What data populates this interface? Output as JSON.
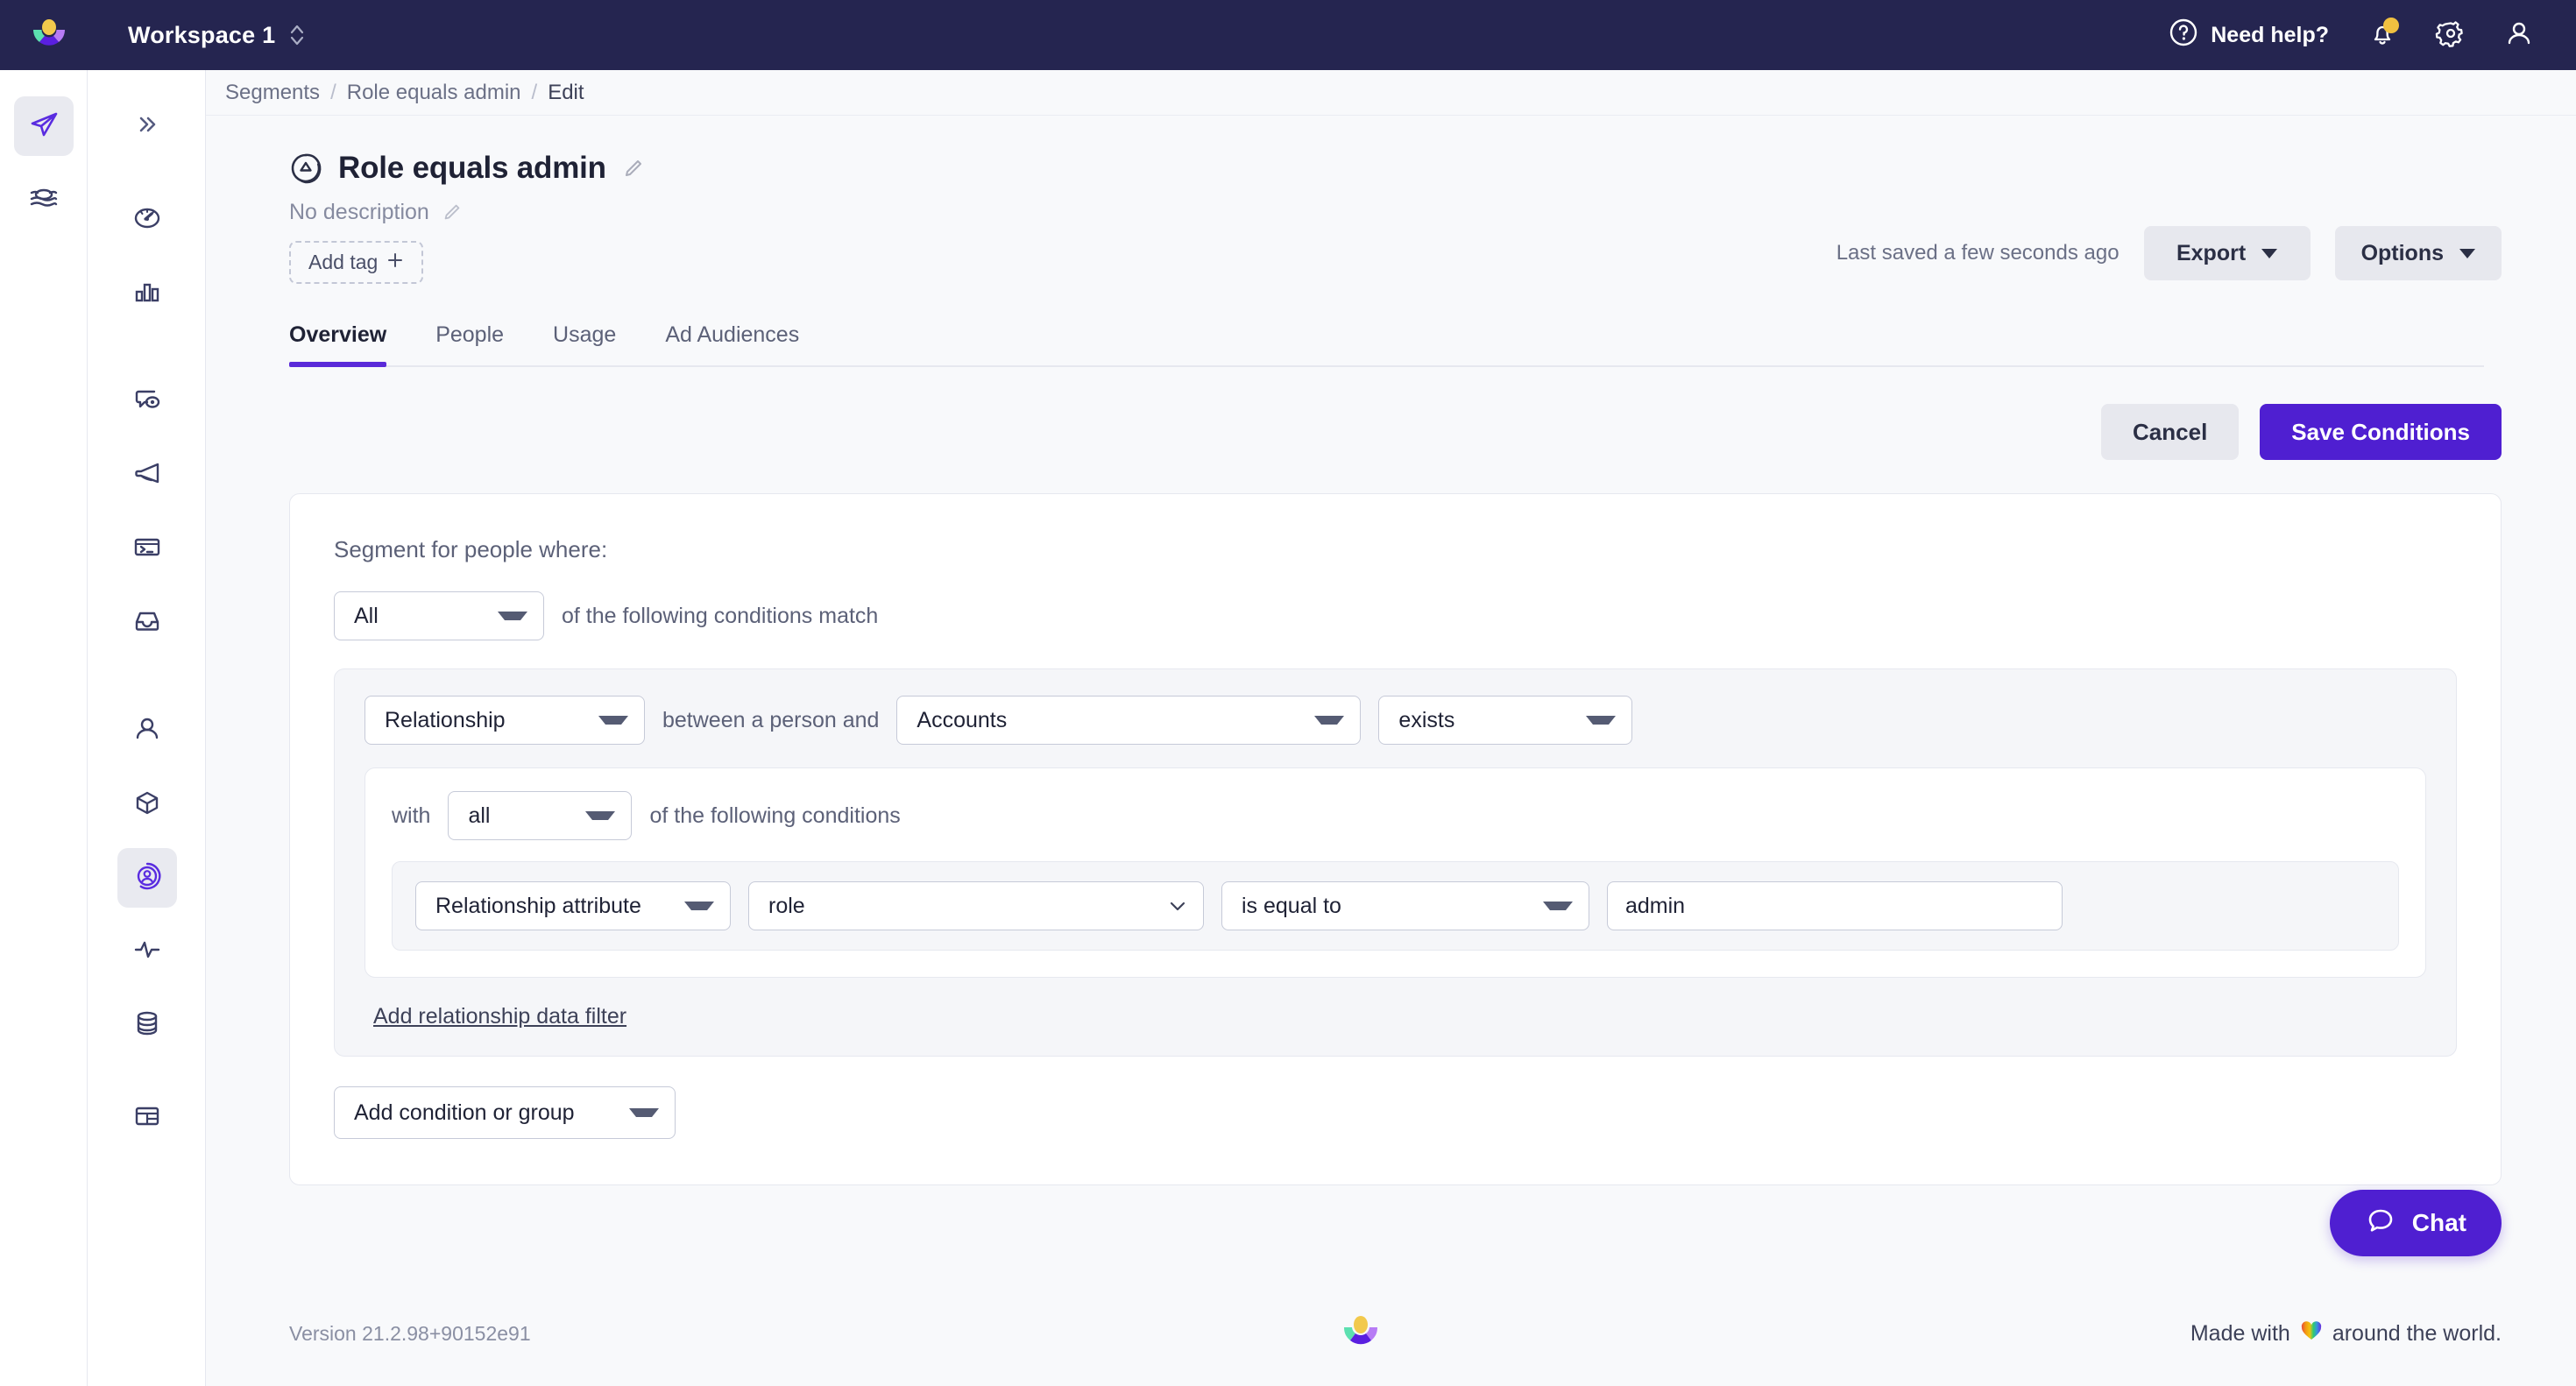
{
  "topbar": {
    "workspace": "Workspace 1",
    "need_help": "Need help?",
    "icons": {
      "logo": "customerio-logo",
      "workspace_switcher": "chevron-up-down-icon",
      "help": "question-circle-icon",
      "notifications": "bell-icon",
      "settings": "gear-icon",
      "account": "user-icon"
    }
  },
  "rail_primary": {
    "items": [
      {
        "name": "sidebar-item-campaigns",
        "icon": "paper-plane-icon",
        "active": true
      },
      {
        "name": "sidebar-item-data",
        "icon": "layers-icon",
        "active": false
      }
    ]
  },
  "rail_secondary": {
    "collapse_icon": "chevron-double-right-icon",
    "items": [
      {
        "name": "sidebar-item-dashboard",
        "icon": "gauge-icon",
        "active": false
      },
      {
        "name": "sidebar-item-analytics",
        "icon": "bar-chart-icon",
        "active": false
      },
      {
        "name": "sidebar-item-messages",
        "icon": "message-eye-icon",
        "active": false
      },
      {
        "name": "sidebar-item-broadcasts",
        "icon": "megaphone-icon",
        "active": false
      },
      {
        "name": "sidebar-item-snippets",
        "icon": "terminal-icon",
        "active": false
      },
      {
        "name": "sidebar-item-inbox",
        "icon": "inbox-icon",
        "active": false
      },
      {
        "name": "sidebar-item-people",
        "icon": "person-icon",
        "active": false
      },
      {
        "name": "sidebar-item-objects",
        "icon": "cube-icon",
        "active": false
      },
      {
        "name": "sidebar-item-segments",
        "icon": "person-circle-icon",
        "active": true
      },
      {
        "name": "sidebar-item-activity",
        "icon": "pulse-icon",
        "active": false
      },
      {
        "name": "sidebar-item-data-sources",
        "icon": "database-icon",
        "active": false
      },
      {
        "name": "sidebar-item-collections",
        "icon": "table-icon",
        "active": false
      }
    ]
  },
  "breadcrumb": {
    "items": [
      "Segments",
      "Role equals admin",
      "Edit"
    ],
    "separator": "/"
  },
  "header": {
    "title": "Role equals admin",
    "title_icon": "segment-icon",
    "edit_title_icon": "pencil-icon",
    "description": "No description",
    "edit_description_icon": "pencil-icon",
    "add_tag": "Add tag",
    "add_tag_icon": "plus-icon",
    "saved_status": "Last saved a few seconds ago",
    "export_label": "Export",
    "options_label": "Options"
  },
  "tabs": [
    {
      "label": "Overview",
      "active": true
    },
    {
      "label": "People",
      "active": false
    },
    {
      "label": "Usage",
      "active": false
    },
    {
      "label": "Ad Audiences",
      "active": false
    }
  ],
  "actions": {
    "cancel": "Cancel",
    "save": "Save Conditions"
  },
  "segment_builder": {
    "intro": "Segment for people where:",
    "match_type": "All",
    "match_suffix": "of the following conditions match",
    "condition": {
      "type": "Relationship",
      "between_text": "between a person and",
      "object": "Accounts",
      "operator": "exists",
      "with_prefix": "with",
      "with_value": "all",
      "with_suffix": "of the following conditions",
      "filter": {
        "attribute_type": "Relationship attribute",
        "attribute": "role",
        "comparator": "is equal to",
        "value": "admin"
      },
      "add_filter_link": "Add relationship data filter"
    },
    "add_condition": "Add condition or group"
  },
  "footer": {
    "version": "Version 21.2.98+90152e91",
    "made_with_prefix": "Made with",
    "made_with_suffix": "around the world.",
    "heart_icon": "rainbow-heart-icon",
    "logo_icon": "customerio-mark-icon"
  },
  "chat": {
    "label": "Chat",
    "icon": "chat-bubble-icon"
  },
  "colors": {
    "topbar_bg": "#252550",
    "accent": "#4f1fd1",
    "tab_underline": "#5b2bd9",
    "page_bg": "#f8f9fb",
    "badge_yellow": "#f0c040"
  }
}
